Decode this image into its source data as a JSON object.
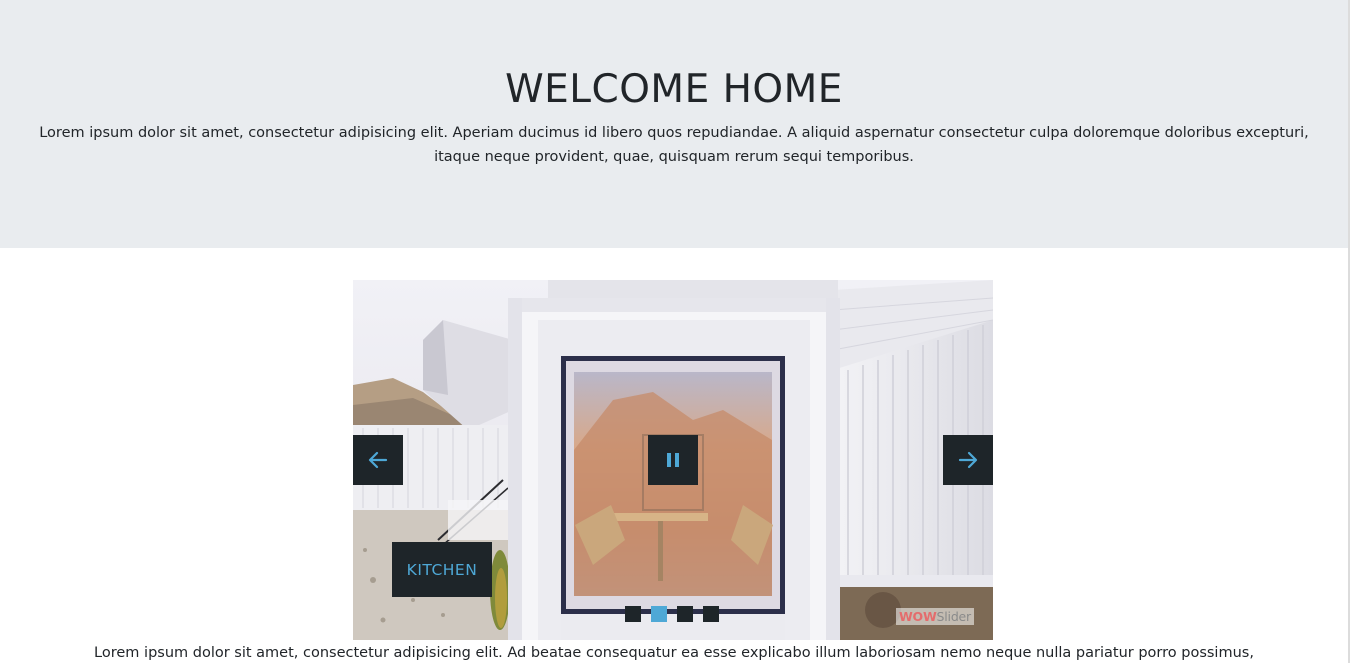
{
  "hero": {
    "title": "WELCOME HOME",
    "text": "Lorem ipsum dolor sit amet, consectetur adipisicing elit. Aperiam ducimus id libero quos repudiandae. A aliquid aspernatur consectetur culpa doloremque doloribus excepturi, itaque neque provident, quae, quisquam rerum sequi temporibus."
  },
  "slider": {
    "caption": "KITCHEN",
    "watermark_part1": "WOW",
    "watermark_part2": "Slider",
    "slides_count": 4,
    "active_slide": 2,
    "icons": {
      "prev": "arrow-left-icon",
      "next": "arrow-right-icon",
      "pause": "pause-icon"
    },
    "colors": {
      "control_bg": "#1e2529",
      "accent": "#4ea8d6"
    }
  },
  "body": {
    "text": "Lorem ipsum dolor sit amet, consectetur adipisicing elit. Ad beatae consequatur ea esse explicabo illum laboriosam nemo neque nulla pariatur porro possimus,"
  },
  "colors": {
    "hero_bg": "#e9ecef",
    "text": "#212529"
  }
}
